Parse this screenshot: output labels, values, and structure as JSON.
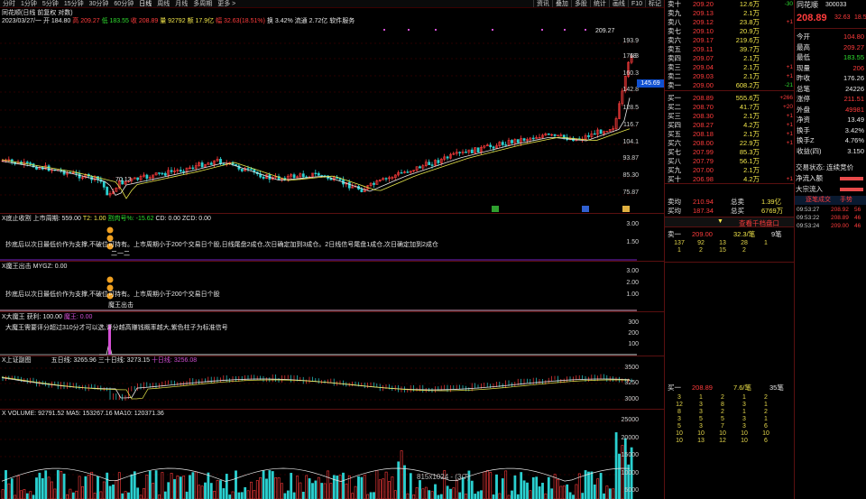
{
  "toolbar": {
    "periods": [
      "分时",
      "1分钟",
      "5分钟",
      "15分钟",
      "30分钟",
      "60分钟",
      "日线",
      "周线",
      "月线",
      "多周期",
      "更多 >"
    ],
    "right": [
      "资讯",
      "叠加",
      "多股",
      "统计",
      "画线",
      "F10",
      "标记"
    ],
    "active": "日线"
  },
  "info": {
    "left": "同花顺(日线 前复权 对数)",
    "date": "2023/03/27/一",
    "open": "开 184.80",
    "high": "高 209.27",
    "low": "低 183.55",
    "close": "收 208.89",
    "volume": "量 92792",
    "amount": "额 17.9亿",
    "change": "幅 32.63(18.51%)",
    "turnover": "换 3.42%",
    "float": "流通 2.72亿",
    "sector": "软件服务"
  },
  "kline": {
    "axis": [
      "193.9",
      "176.3",
      "160.3",
      "142.8",
      "128.5",
      "116.7",
      "104.1",
      "93.87",
      "85.30",
      "75.87"
    ],
    "current_price": "145.69",
    "high_label": "209.27",
    "low_label": "70.13",
    "close_mark": "18"
  },
  "ind1": {
    "title": "X底止收割",
    "periods": "上市周期: 559.00",
    "t2": "T2: 1.00",
    "risk": "割肉号%: -15.62",
    "cd": "CD: 0.00",
    "zcd": "ZCD: 0.00",
    "note": "抄底后以次日最低价作为支撑,不破位可持有。上市周期小于200个交易日个股,日线尾盘2成仓,次日确定加到3成仓。2日线信号尾盘1成仓,次日确定加到2成仓",
    "mark": "二一二",
    "axis": [
      "3.00",
      "1.50"
    ]
  },
  "ind2": {
    "title": "X魔王出击",
    "mygz": "MYGZ: 0.00",
    "note": "抄底后以次日最低价作为支撑,不破位可持有。上市周期小于200个交易日个股",
    "mark": "魔王出击",
    "axis": [
      "3.00",
      "2.00",
      "1.00"
    ]
  },
  "ind3": {
    "title": "X大魔王",
    "prob": "获利: 100.00",
    "dmw": "魔王: 0.00",
    "note": "大魔王需要评分超过310分才可以选,评分越高赚钱概率越大,紫色柱子为标准信号",
    "axis": [
      "300",
      "200",
      "100"
    ]
  },
  "ind4": {
    "title": "X上证副图",
    "ma5": "五日线: 3265.96",
    "ma30": "三十日线: 3273.15",
    "ma10": "十日线: 3256.08",
    "axis": [
      "3500",
      "3250",
      "3000"
    ]
  },
  "vol": {
    "title": "X VOLUME: 92791.52",
    "ma5": "MA5: 153267.16",
    "ma10": "MA10: 120371.36",
    "axis": [
      "25000",
      "20000",
      "15000",
      "10000",
      "5000"
    ],
    "watermark": "815x1024 - (3/7)"
  },
  "orderbook": {
    "asks": [
      [
        "卖十",
        "209.20",
        "12.6万",
        "-30"
      ],
      [
        "卖九",
        "209.13",
        "2.1万",
        ""
      ],
      [
        "卖八",
        "209.12",
        "23.8万",
        "+1"
      ],
      [
        "卖七",
        "209.10",
        "20.9万",
        ""
      ],
      [
        "卖六",
        "209.17",
        "219.6万",
        ""
      ],
      [
        "卖五",
        "209.11",
        "39.7万",
        ""
      ],
      [
        "卖四",
        "209.07",
        "2.1万",
        ""
      ],
      [
        "卖三",
        "209.04",
        "2.1万",
        "+1"
      ],
      [
        "卖二",
        "209.03",
        "2.1万",
        "+1"
      ],
      [
        "卖一",
        "209.00",
        "608.2万",
        "-21"
      ]
    ],
    "bids": [
      [
        "买一",
        "208.89",
        "555.6万",
        "+266"
      ],
      [
        "买二",
        "208.70",
        "41.7万",
        "+20"
      ],
      [
        "买三",
        "208.30",
        "2.1万",
        "+1"
      ],
      [
        "买四",
        "208.27",
        "4.2万",
        "+1"
      ],
      [
        "买五",
        "208.18",
        "2.1万",
        "+1"
      ],
      [
        "买六",
        "208.00",
        "22.9万",
        "+1"
      ],
      [
        "买七",
        "207.99",
        "85.3万",
        ""
      ],
      [
        "买八",
        "207.79",
        "56.1万",
        ""
      ],
      [
        "买九",
        "207.00",
        "2.1万",
        ""
      ],
      [
        "买十",
        "206.98",
        "4.2万",
        "+1"
      ]
    ],
    "ask_total": [
      "卖均",
      "210.94",
      "总卖",
      "1.39亿"
    ],
    "bid_total": [
      "买均",
      "187.34",
      "总买",
      "6769万"
    ],
    "link": "查看千档盘口"
  },
  "queue_ask": {
    "label": "卖一",
    "price": "209.00",
    "vol": "32.3/笔",
    "count": "9笔",
    "rows": [
      [
        "137",
        "92",
        "13",
        "28",
        "1"
      ],
      [
        "1",
        "2",
        "15",
        "2",
        ""
      ]
    ]
  },
  "queue_bid": {
    "label": "买一",
    "price": "208.89",
    "vol": "7.6/笔",
    "count": "35笔",
    "rows": [
      [
        "3",
        "1",
        "2",
        "1",
        "2"
      ],
      [
        "12",
        "3",
        "8",
        "3",
        "1"
      ],
      [
        "8",
        "3",
        "2",
        "1",
        "2"
      ],
      [
        "3",
        "5",
        "5",
        "3",
        "1"
      ],
      [
        "5",
        "3",
        "7",
        "3",
        "6"
      ],
      [
        "10",
        "10",
        "10",
        "10",
        "10"
      ],
      [
        "10",
        "13",
        "12",
        "10",
        "6"
      ]
    ]
  },
  "quote": {
    "name": "同花顺",
    "code": "300033",
    "price": "208.89",
    "change": "32.63",
    "pct": "18.5",
    "rows": [
      [
        "今开",
        "104.80"
      ],
      [
        "最高",
        "209.27"
      ],
      [
        "最低",
        "183.55"
      ],
      [
        "现量",
        "206"
      ],
      [
        "昨收",
        "176.26"
      ],
      [
        "总笔",
        "24226"
      ],
      [
        "涨停",
        "211.51"
      ],
      [
        "外盘",
        "49981"
      ],
      [
        "净资",
        "13.49"
      ],
      [
        "换手",
        "3.42%"
      ],
      [
        "换手Z",
        "4.76%"
      ],
      [
        "收益(四)",
        "3.150"
      ]
    ],
    "status": "交易状态: 连续竞价",
    "flow1": "净流入额",
    "flow2": "大宗流入",
    "trade_tabs": [
      "逐笔成交",
      "手势"
    ],
    "trades": [
      [
        "09:53:27",
        "208.92",
        "56"
      ],
      [
        "09:53:22",
        "208.89",
        "46"
      ],
      [
        "09:53:24",
        "209.00",
        "46"
      ]
    ]
  }
}
